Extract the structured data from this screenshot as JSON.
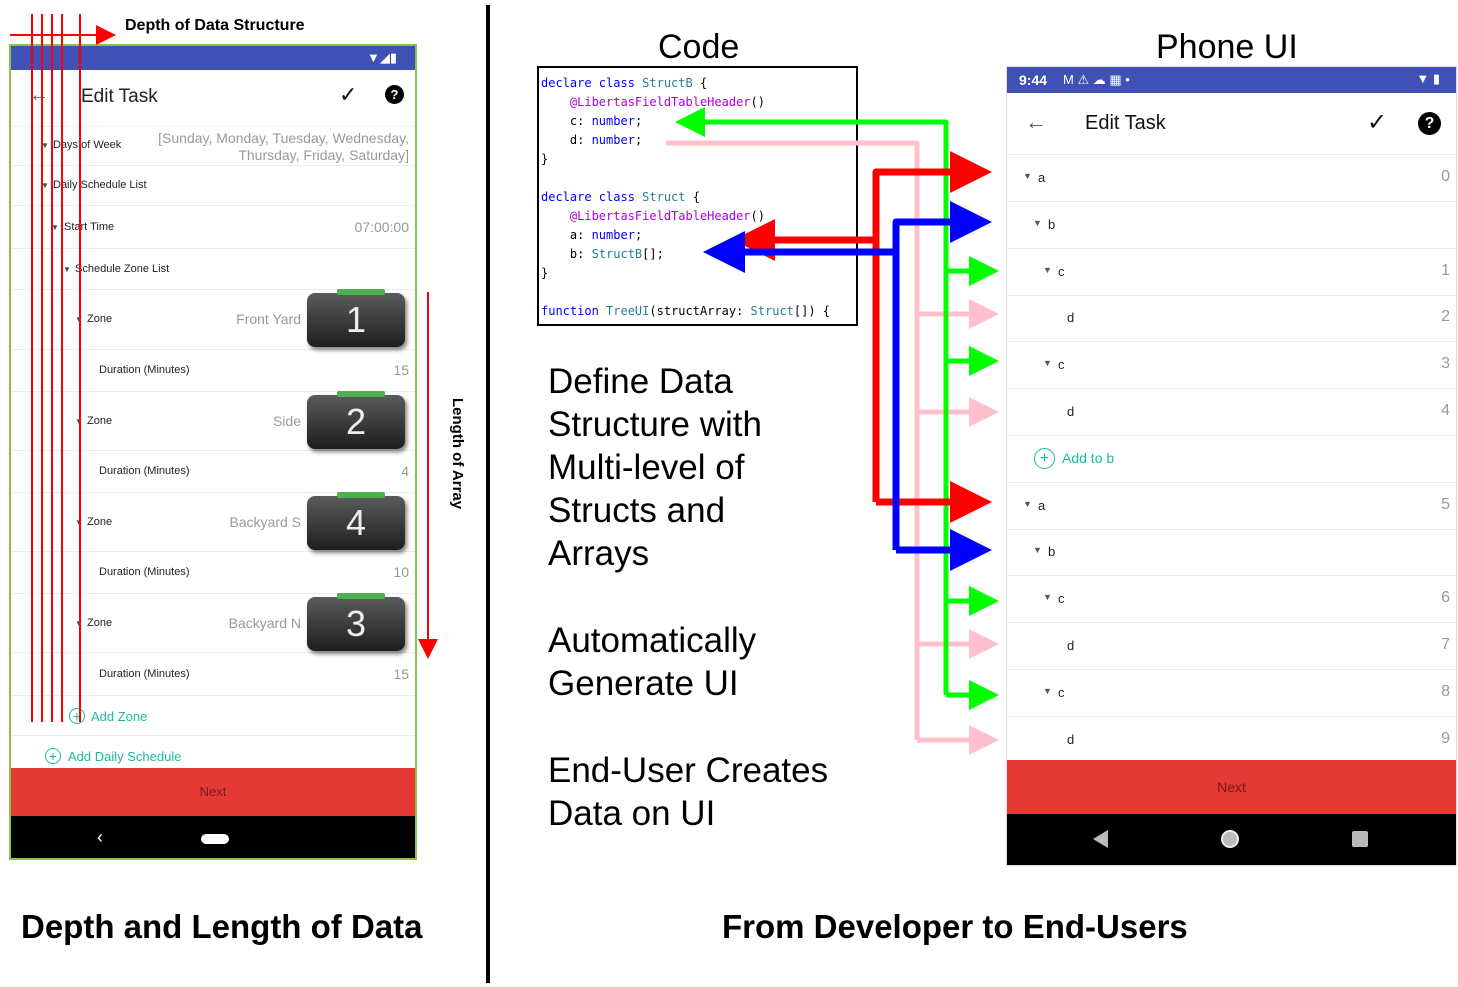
{
  "left_panel": {
    "depth_label": "Depth of Data Structure",
    "length_label": "Length of Array",
    "caption": "Depth and Length of Data",
    "phone": {
      "title": "Edit Task",
      "rows": [
        {
          "label": "Days of Week",
          "value": "[Sunday, Monday, Tuesday, Wednesday,",
          "value2": "Thursday, Friday, Saturday]"
        },
        {
          "label": "Daily Schedule List"
        },
        {
          "label": "Start Time",
          "value": "07:00:00"
        },
        {
          "label": "Schedule Zone List"
        },
        {
          "label": "Zone",
          "value": "Front Yard",
          "device": "1"
        },
        {
          "label": "Duration (Minutes)",
          "value": "15"
        },
        {
          "label": "Zone",
          "value": "Side",
          "device": "2"
        },
        {
          "label": "Duration (Minutes)",
          "value": "4"
        },
        {
          "label": "Zone",
          "value": "Backyard S",
          "device": "4"
        },
        {
          "label": "Duration (Minutes)",
          "value": "10"
        },
        {
          "label": "Zone",
          "value": "Backyard N",
          "device": "3"
        },
        {
          "label": "Duration (Minutes)",
          "value": "15"
        }
      ],
      "add_zone": "Add Zone",
      "add_daily_schedule": "Add Daily Schedule",
      "next": "Next"
    }
  },
  "right_panel": {
    "caption": "From Developer to End-Users",
    "code_title": "Code",
    "phone_title": "Phone UI",
    "code_lines": [
      [
        {
          "t": "kw",
          "s": "declare class "
        },
        {
          "t": "tp",
          "s": "StructB"
        },
        {
          "t": "tx",
          "s": " {"
        }
      ],
      [
        {
          "t": "tx",
          "s": "    "
        },
        {
          "t": "an",
          "s": "@LibertasFieldTableHeader"
        },
        {
          "t": "tx",
          "s": "()"
        }
      ],
      [
        {
          "t": "tx",
          "s": "    c: "
        },
        {
          "t": "kw",
          "s": "number"
        },
        {
          "t": "tx",
          "s": ";"
        }
      ],
      [
        {
          "t": "tx",
          "s": "    d: "
        },
        {
          "t": "kw",
          "s": "number"
        },
        {
          "t": "tx",
          "s": ";"
        }
      ],
      [
        {
          "t": "tx",
          "s": "}"
        }
      ],
      [
        {
          "t": "tx",
          "s": ""
        }
      ],
      [
        {
          "t": "kw",
          "s": "declare class "
        },
        {
          "t": "tp",
          "s": "Struct"
        },
        {
          "t": "tx",
          "s": " {"
        }
      ],
      [
        {
          "t": "tx",
          "s": "    "
        },
        {
          "t": "an",
          "s": "@LibertasFieldTableHeader"
        },
        {
          "t": "tx",
          "s": "()"
        }
      ],
      [
        {
          "t": "tx",
          "s": "    a: "
        },
        {
          "t": "kw",
          "s": "number"
        },
        {
          "t": "tx",
          "s": ";"
        }
      ],
      [
        {
          "t": "tx",
          "s": "    b: "
        },
        {
          "t": "tp",
          "s": "StructB"
        },
        {
          "t": "tx",
          "s": "[];"
        }
      ],
      [
        {
          "t": "tx",
          "s": "}"
        }
      ],
      [
        {
          "t": "tx",
          "s": ""
        }
      ],
      [
        {
          "t": "kw",
          "s": "function "
        },
        {
          "t": "tp",
          "s": "TreeUI"
        },
        {
          "t": "tx",
          "s": "(structArray: "
        },
        {
          "t": "tp",
          "s": "Struct"
        },
        {
          "t": "tx",
          "s": "[]) {"
        }
      ]
    ],
    "desc1": [
      "Define Data",
      "Structure with",
      "Multi-level of",
      "Structs and",
      "Arrays"
    ],
    "desc2": [
      "Automatically",
      "Generate UI"
    ],
    "desc3": [
      "End-User Creates",
      "Data on UI"
    ],
    "phone": {
      "time": "9:44",
      "title": "Edit Task",
      "rows": [
        {
          "label": "a",
          "value": "0",
          "caret": true
        },
        {
          "label": "b",
          "value": "",
          "caret": true
        },
        {
          "label": "c",
          "value": "1",
          "caret": true
        },
        {
          "label": "d",
          "value": "2",
          "caret": false
        },
        {
          "label": "c",
          "value": "3",
          "caret": true
        },
        {
          "label": "d",
          "value": "4",
          "caret": false
        },
        {
          "label": "Add to b",
          "value": "",
          "add": true
        },
        {
          "label": "a",
          "value": "5",
          "caret": true
        },
        {
          "label": "b",
          "value": "",
          "caret": true
        },
        {
          "label": "c",
          "value": "6",
          "caret": true
        },
        {
          "label": "d",
          "value": "7",
          "caret": false
        },
        {
          "label": "c",
          "value": "8",
          "caret": true
        },
        {
          "label": "d",
          "value": "9",
          "caret": false
        }
      ],
      "next": "Next"
    }
  },
  "colors": {
    "red": "#ff0000",
    "blue": "#0000ff",
    "green": "#00ff00",
    "pink": "#ffc0cb",
    "next_bar": "#e53935",
    "status_bar": "#3f51b5"
  }
}
